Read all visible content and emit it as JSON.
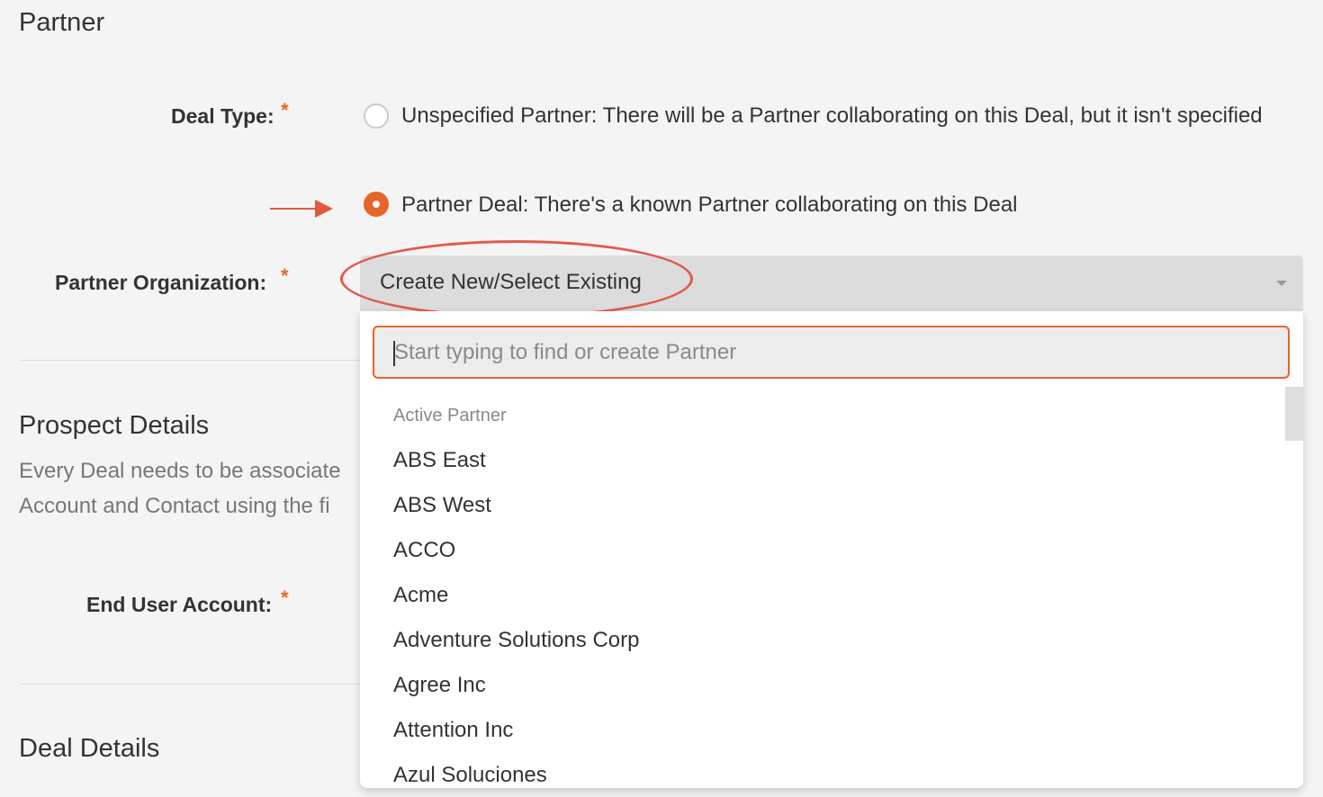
{
  "partner_section": {
    "title": "Partner",
    "deal_type": {
      "label": "Deal Type:",
      "required_mark": "*",
      "options": [
        {
          "label": "Unspecified Partner: There will be a Partner collaborating on this Deal, but it isn't specified",
          "selected": false
        },
        {
          "label": "Partner Deal: There's a known Partner collaborating on this Deal",
          "selected": true
        }
      ]
    },
    "partner_org": {
      "label": "Partner Organization:",
      "required_mark": "*",
      "value": "Create New/Select Existing"
    }
  },
  "prospect_section": {
    "title": "Prospect Details",
    "description_line1": "Every Deal needs to be associate",
    "description_line2": "Account and Contact using the fi",
    "end_user_account": {
      "label": "End User Account:",
      "required_mark": "*"
    }
  },
  "deal_section": {
    "title": "Deal Details"
  },
  "dropdown": {
    "search_placeholder": "Start typing to find or create Partner",
    "group_label": "Active Partner",
    "options": [
      "ABS East",
      "ABS West",
      "ACCO",
      "Acme",
      "Adventure Solutions Corp",
      "Agree Inc",
      "Attention Inc",
      "Azul Soluciones"
    ]
  },
  "colors": {
    "accent": "#e8652a",
    "annotation": "#e05a3e",
    "background": "#f4f4f4"
  },
  "annotations": {
    "arrow": "right-arrow",
    "ellipse": "highlight-ellipse"
  }
}
